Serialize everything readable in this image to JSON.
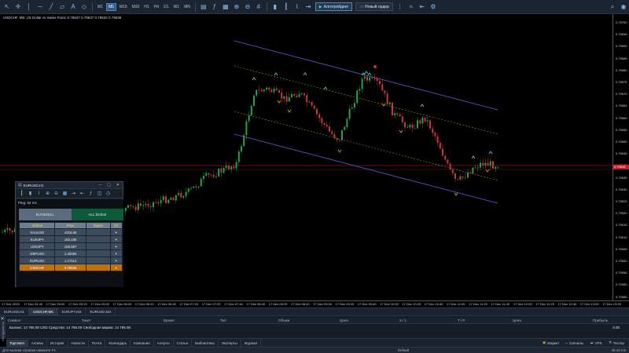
{
  "toolbar": {
    "timeframes": [
      "M1",
      "M5",
      "M15",
      "M30",
      "H1",
      "H4",
      "D1",
      "W1",
      "MN"
    ],
    "active_timeframe": "M5",
    "algo_label": "Алготрейдинг",
    "new_order_label": "Новый ордер"
  },
  "chart": {
    "title": "USDCHF, M5: US Dollar vs Swiss Franc  0.79637 0.79637 0.79634 0.79636",
    "current_price": "0.79636",
    "price_axis": [
      "0.79700",
      "0.79695",
      "0.79690",
      "0.79685",
      "0.79680",
      "0.79675",
      "0.79670",
      "0.79665",
      "0.79660",
      "0.79655",
      "0.79650",
      "0.79645",
      "0.79640",
      "0.79635",
      "0.79630",
      "0.79625",
      "0.79620",
      "0.79615",
      "0.79610",
      "0.79605",
      "0.79600",
      "0.79595",
      "0.79590",
      "0.79585"
    ],
    "time_axis": [
      "17 Dec 2025",
      "17 Dec 04:40",
      "17 Dec 05:00",
      "17 Dec 05:20",
      "17 Dec 05:40",
      "17 Dec 06:00",
      "17 Dec 06:20",
      "17 Dec 06:40",
      "17 Dec 07:00",
      "17 Dec 07:20",
      "17 Dec 07:40",
      "17 Dec 08:00",
      "17 Dec 08:20",
      "17 Dec 08:40",
      "17 Dec 09:00",
      "17 Dec 09:20",
      "17 Dec 09:40",
      "17 Dec 10:00",
      "17 Dec 10:20",
      "17 Dec 10:40",
      "17 Dec 11:00",
      "17 Dec 11:20",
      "17 Dec 11:40",
      "17 Dec 12:00",
      "17 Dec 12:20",
      "17 Dec 12:40",
      "17 Dec 13:00",
      "17 Dec 13:20"
    ]
  },
  "chart_tabs": [
    "EURUSD,H1",
    "USDCHF,M5",
    "EURJPY,M3",
    "EURUSD,M3"
  ],
  "active_chart_tab": "USDCHF,M5",
  "terminal": {
    "side_label": "Инструменты",
    "columns": [
      "Символ",
      "Тикет",
      "Время",
      "Тип",
      "Объем",
      "Цена",
      "S / L",
      "T / P",
      "Цена",
      "Прибыль"
    ],
    "balance_text": "Баланс: 14 765.00 USD  Средства: 14 765.00  Свободная маржа: 14 765.00",
    "balance_value": "0.00"
  },
  "bottom_tabs": [
    "Торговля",
    "Активы",
    "История",
    "Новости",
    "Почта",
    "Календарь",
    "Компания",
    "Алерты",
    "Статьи",
    "Библиотека",
    "Эксперты",
    "Журнал"
  ],
  "bottom_right": [
    "Маркет",
    "Сигналы",
    "VPS",
    "Тестер"
  ],
  "status": {
    "left": "Для вызова справки нажмите F1",
    "mid": "Default",
    "right": "46.40 ms"
  },
  "panel": {
    "title": "EURUSD,H1",
    "ping": "Ping: 94 ms",
    "tab_buysell": "BUY&SELL",
    "tab_all": "ALL Simbol",
    "headers": [
      "Simbol",
      "Price",
      "Signal",
      "Ch"
    ],
    "rows": [
      {
        "symbol": "XAUUSD",
        "price": "4316.65",
        "signal": "",
        "ch": "+"
      },
      {
        "symbol": "EURJPY",
        "price": "182.180",
        "signal": "",
        "ch": "+"
      },
      {
        "symbol": "USDJPY",
        "price": "155.557",
        "signal": "",
        "ch": "+"
      },
      {
        "symbol": "GBPUSD",
        "price": "1.33350",
        "signal": "",
        "ch": "+"
      },
      {
        "symbol": "EURUSD",
        "price": "1.17114",
        "signal": "",
        "ch": "+"
      },
      {
        "symbol": "USDCHF",
        "price": "0.79636",
        "signal": "",
        "ch": "+"
      }
    ],
    "highlight_symbol": "USDCHF"
  },
  "colors": {
    "bull": "#2f9d4a",
    "bear": "#c23a3a",
    "channel": "#5a5ad8",
    "midline": "#9a8a2a",
    "buy_marker": "#4fe0c0",
    "sell_marker": "#e0a020",
    "price_line": "#c8202a"
  }
}
